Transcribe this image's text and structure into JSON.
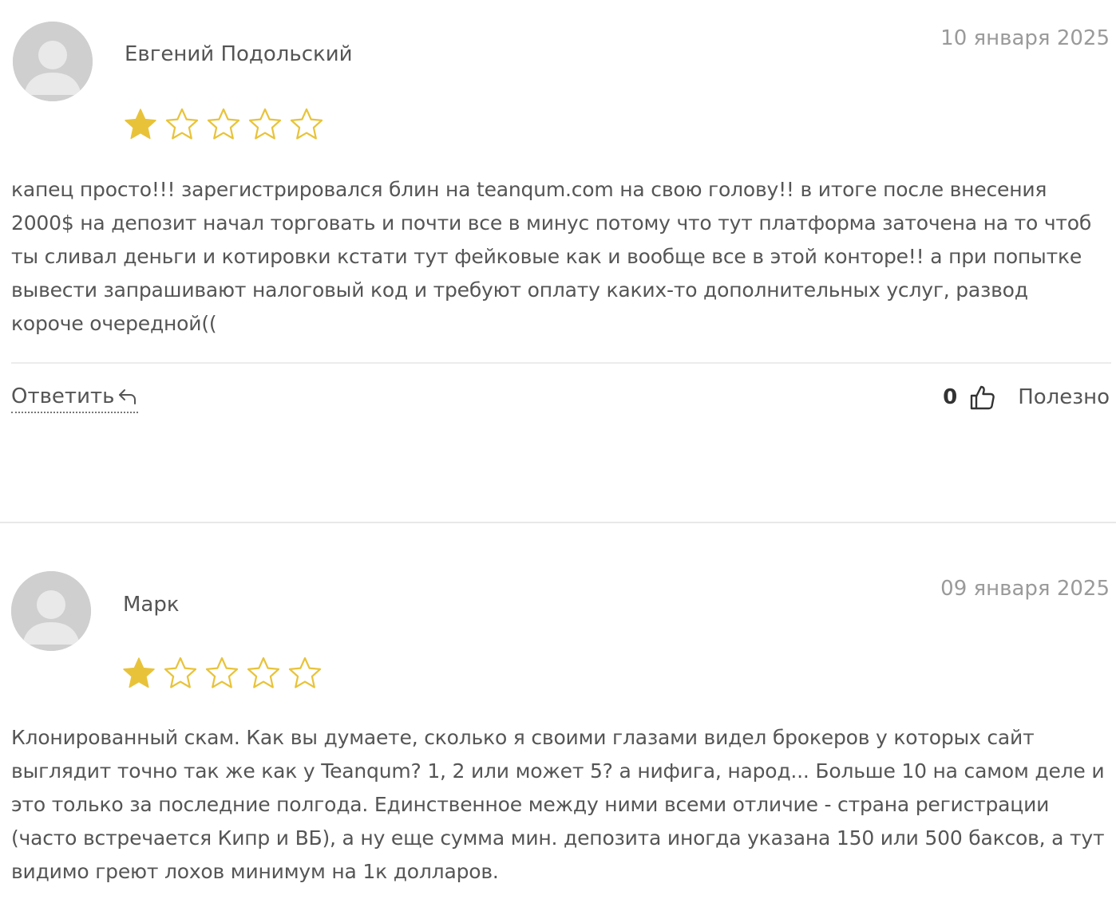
{
  "reviews": [
    {
      "author": "Евгений Подольский",
      "date": "10 января 2025",
      "rating": 1,
      "max_rating": 5,
      "text": "капец просто!!! зарегистрировался блин на teanqum.com на свою голову!! в итоге после внесения 2000$ на депозит начал торговать и почти все в минус потому что тут платформа заточена на то чтоб ты сливал деньги и котировки кстати тут фейковые как и вообще все в этой конторе!! а при попытке вывести запрашивают налоговый код и требуют оплату каких-то дополнительных услуг, развод короче очередной((",
      "reply_label": "Ответить",
      "helpful_count": "0",
      "helpful_label": "Полезно"
    },
    {
      "author": "Марк",
      "date": "09 января 2025",
      "rating": 1,
      "max_rating": 5,
      "text": "Клонированный скам. Как вы думаете, сколько я своими глазами видел брокеров у которых сайт выглядит точно так же как у Teanqum? 1, 2 или может 5? а нифига, народ... Больше 10 на самом деле и это только за последние полгода. Единственное между ними всеми отличие - страна регистрации (часто встречается Кипр и ВБ), а ну еще сумма мин. депозита иногда указана 150 или 500 баксов, а тут видимо греют лохов минимум на 1к долларов."
    }
  ],
  "colors": {
    "star_filled": "#e8c33a",
    "star_outline": "#e8c33a",
    "avatar_bg": "#cfcfcf",
    "avatar_fg": "#e9e9e9"
  },
  "icons": {
    "avatar": "user-silhouette-icon",
    "star": "star-icon",
    "reply": "reply-arrow-icon",
    "helpful": "thumbs-up-icon"
  }
}
